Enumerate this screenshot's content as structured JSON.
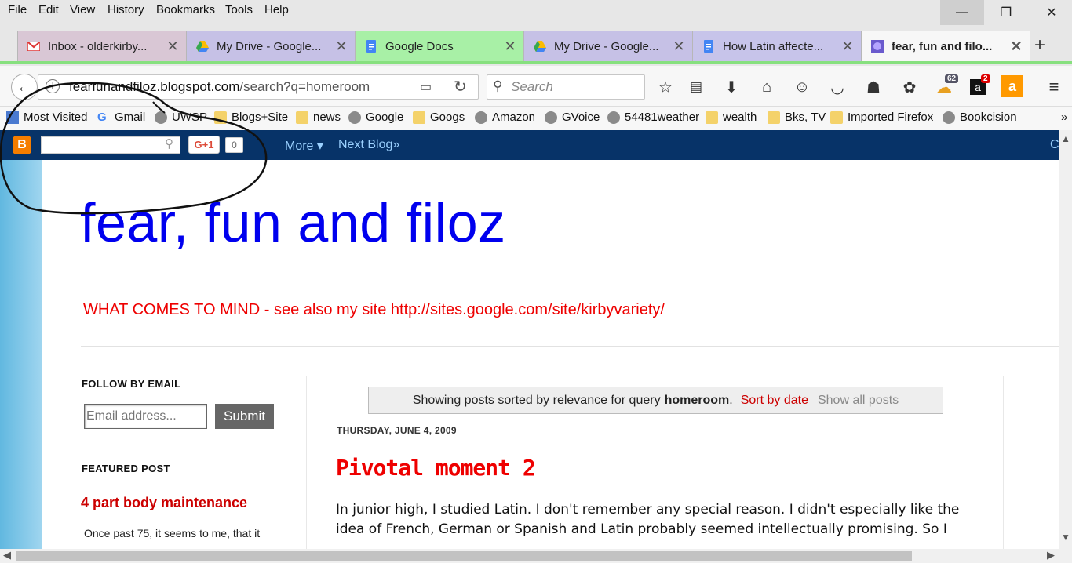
{
  "menu": [
    "File",
    "Edit",
    "View",
    "History",
    "Bookmarks",
    "Tools",
    "Help"
  ],
  "window_controls": {
    "minimize": "—",
    "restore": "❐",
    "close": "✕"
  },
  "tabs": [
    {
      "label": "Inbox - olderkirby...",
      "close": "✕",
      "icon": "gmail-icon"
    },
    {
      "label": "My Drive - Google...",
      "close": "✕",
      "icon": "drive-icon"
    },
    {
      "label": "Google Docs",
      "close": "✕",
      "icon": "docs-icon"
    },
    {
      "label": "My Drive - Google...",
      "close": "✕",
      "icon": "drive-icon"
    },
    {
      "label": "How Latin affecte...",
      "close": "✕",
      "icon": "docs-icon"
    },
    {
      "label": "fear, fun and filo...",
      "close": "✕",
      "icon": "blog-icon"
    }
  ],
  "new_tab": "+",
  "nav": {
    "back": "←",
    "url_domain": "fearfunandfiloz.blogspot.com",
    "url_path": "/search?q=homeroom",
    "search_placeholder": "Search",
    "badge_count_1": "62",
    "badge_count_2": "2"
  },
  "bookmarks": [
    "Most Visited",
    "Gmail",
    "UWSP",
    "Blogs+Site",
    "news",
    "Google",
    "Googs",
    "Amazon",
    "GVoice",
    "54481weather",
    "wealth",
    "Bks, TV",
    "Imported Firefox",
    "Bookcision"
  ],
  "blogger_nav": {
    "gplus": "G+1",
    "gplus_count": "0",
    "more": "More ▾",
    "next_blog": "Next Blog»",
    "right_cut": "C"
  },
  "blog": {
    "title": "fear, fun and filoz",
    "description": "WHAT COMES TO MIND - see also my site http://sites.google.com/site/kirbyvariety/"
  },
  "sidebar": {
    "follow_heading": "FOLLOW BY EMAIL",
    "email_placeholder": "Email address...",
    "submit": "Submit",
    "featured_heading": "FEATURED POST",
    "featured_title": "4 part body maintenance",
    "featured_snippet": "Once past 75, it seems to me, that it"
  },
  "search_status": {
    "prefix": "Showing posts sorted by relevance for query",
    "query": "homeroom",
    "period": ".",
    "sort_by_date": "Sort by date",
    "show_all": "Show all posts"
  },
  "post": {
    "date": "THURSDAY, JUNE 4, 2009",
    "title": "Pivotal moment 2",
    "lines": [
      "In junior high, I studied Latin.  I don't remember any special reason.  I didn't especially like the",
      "idea of French, German or Spanish and Latin probably seemed intellectually promising.  So I"
    ]
  },
  "colors": {
    "blogger_nav": "#073368",
    "title_blue": "#0000ee",
    "accent_red": "#cc0000"
  }
}
